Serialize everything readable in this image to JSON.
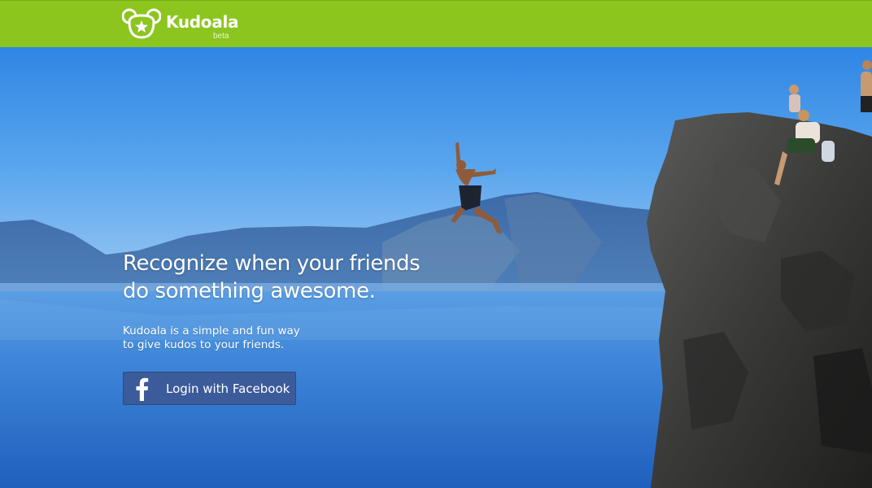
{
  "header": {
    "brand_name": "Kudoala",
    "brand_tag": "beta",
    "background_color": "#8cc51e",
    "logo_icon": "koala-star-icon"
  },
  "hero": {
    "headline_line1": "Recognize when your friends",
    "headline_line2": "do something awesome.",
    "subtext_line1": "Kudoala is a simple and fun way",
    "subtext_line2": "to give kudos to your friends.",
    "login_button_label": "Login with Facebook",
    "login_button_icon": "facebook-icon",
    "login_button_color": "#3b5b9a",
    "background_image": "cliff-jump-lake-photo"
  }
}
